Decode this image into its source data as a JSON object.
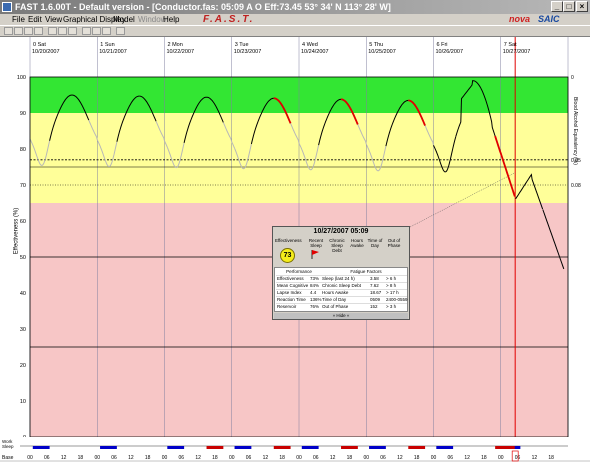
{
  "window": {
    "title": "FAST 1.6.00T - Default version - [Conductor.fas: 05:09 A O Eff:73.45  53° 34' N 113° 28' W]",
    "min": "_",
    "max": "□",
    "close": "×"
  },
  "menu": {
    "items": [
      {
        "label": "File",
        "enabled": true
      },
      {
        "label": "Edit",
        "enabled": true
      },
      {
        "label": "View",
        "enabled": true
      },
      {
        "label": "Graphical Display",
        "enabled": true
      },
      {
        "label": "Model",
        "enabled": true
      },
      {
        "label": "Window",
        "enabled": false
      },
      {
        "label": "Help",
        "enabled": true
      }
    ],
    "brand_fast": "F.A.S.T.",
    "brand_nova": "nova",
    "brand_saic": "SAIC"
  },
  "days": [
    {
      "label": "0 Sat",
      "date": "10/20/2007"
    },
    {
      "label": "1 Sun",
      "date": "10/21/2007"
    },
    {
      "label": "2 Mon",
      "date": "10/22/2007"
    },
    {
      "label": "3 Tue",
      "date": "10/23/2007"
    },
    {
      "label": "4 Wed",
      "date": "10/24/2007"
    },
    {
      "label": "5 Thu",
      "date": "10/25/2007"
    },
    {
      "label": "6 Fri",
      "date": "10/26/2007"
    },
    {
      "label": "7 Sat",
      "date": "10/27/2007"
    }
  ],
  "hour_ticks": [
    "00",
    "06",
    "12",
    "18"
  ],
  "left_ticks": [
    "100",
    "90",
    "80",
    "70",
    "60",
    "50",
    "40",
    "30",
    "20",
    "10",
    "0"
  ],
  "left_axis_label": "Effectiveness (%)",
  "right_ticks": [
    "0",
    "0.05",
    "0.08"
  ],
  "right_axis_label": "Blood Alcohol Equivalency (%)",
  "bottom_labels": {
    "work": "Work",
    "sleep": "Sleep",
    "base": "Base"
  },
  "colors": {
    "green": "#33e633",
    "yellow": "#ffff99",
    "pink": "#f7c6c6",
    "curve_awake": "#000000",
    "curve_sleep": "#b8b8b8",
    "curve_work": "#e00000",
    "sleep_bar": "#0000c8",
    "work_bar": "#c80000",
    "cursor": "#e00000"
  },
  "popup": {
    "datetime": "10/27/2007 05:09",
    "headers": [
      "Effectiveness",
      "Recent Sleep",
      "Chronic Sleep Debt",
      "Hours Awake",
      "Time of Day",
      "Out of Phase"
    ],
    "effectiveness": "73",
    "perf_title": "Performance",
    "fatigue_title": "Fatigue Factors",
    "rows": [
      {
        "perf": "Effectiveness",
        "pval": "73%",
        "factor": "Sleep (last 24 h)",
        "fval": "3.58",
        "fthr": "> 6 h"
      },
      {
        "perf": "Mean Cognitive",
        "pval": "84%",
        "factor": "Chronic Sleep Debt",
        "fval": "7.62",
        "fthr": "> 8 h"
      },
      {
        "perf": "Lapse Index",
        "pval": "4.4",
        "factor": "Hours Awake",
        "fval": "18.67",
        "fthr": "> 17 h"
      },
      {
        "perf": "Reaction Time",
        "pval": "136%",
        "factor": "Time of Day",
        "fval": "0509",
        "fthr": "2400-0559"
      },
      {
        "perf": "Reservoir",
        "pval": "76%",
        "factor": "Out of Phase",
        "fval": "152",
        "fthr": "> 3 h"
      }
    ],
    "hide_label": "» Hide «"
  }
}
